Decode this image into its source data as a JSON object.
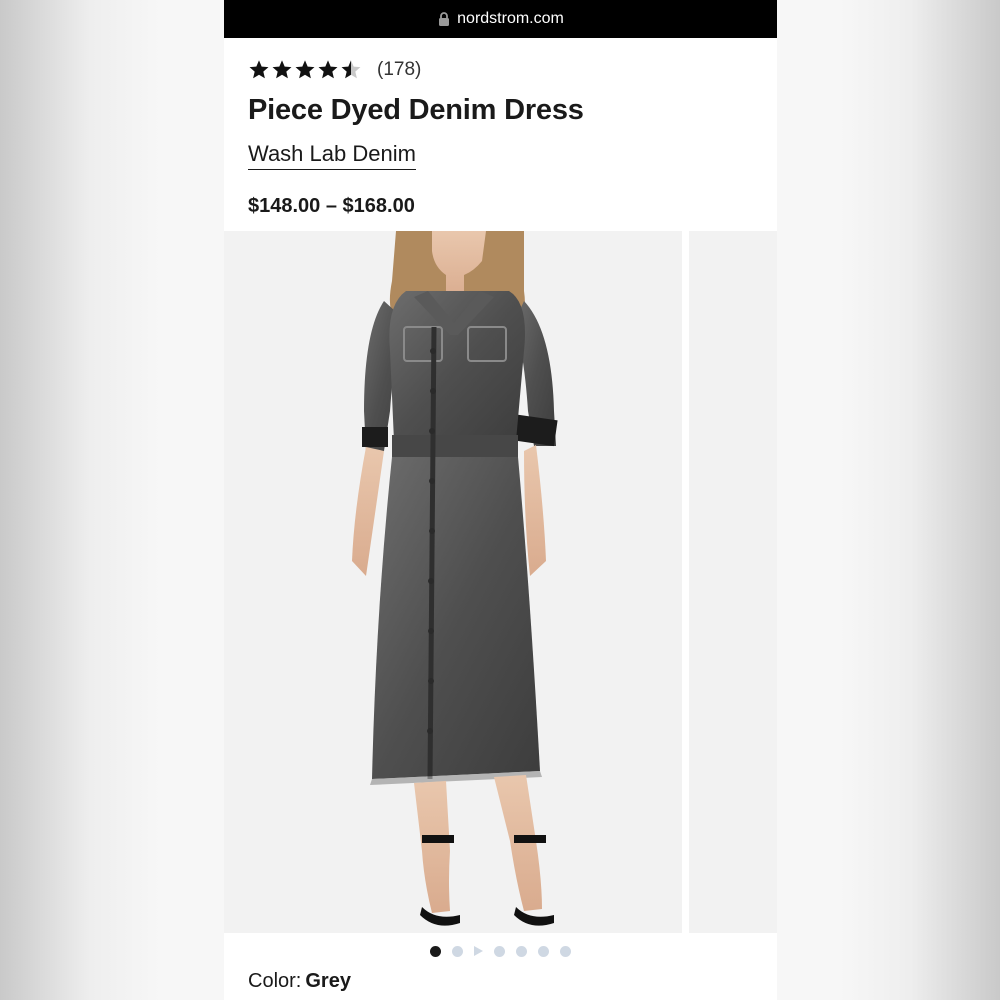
{
  "browser": {
    "url": "nordstrom.com"
  },
  "product": {
    "rating": 4.5,
    "rating_max": 5,
    "review_count": "(178)",
    "title": "Piece Dyed Denim Dress",
    "brand": "Wash Lab Denim",
    "price": "$148.00 – $168.00",
    "color_label": "Color:",
    "color_value": "Grey"
  },
  "gallery": {
    "slide_count": 7,
    "active_index": 0,
    "video_index": 2,
    "image_semantic": "model-wearing-grey-denim-dress"
  },
  "colors": {
    "star": "#111111",
    "star_empty": "#c8c8c8",
    "dot_inactive": "#cfd8e3",
    "dot_active": "#1a1a1a"
  }
}
